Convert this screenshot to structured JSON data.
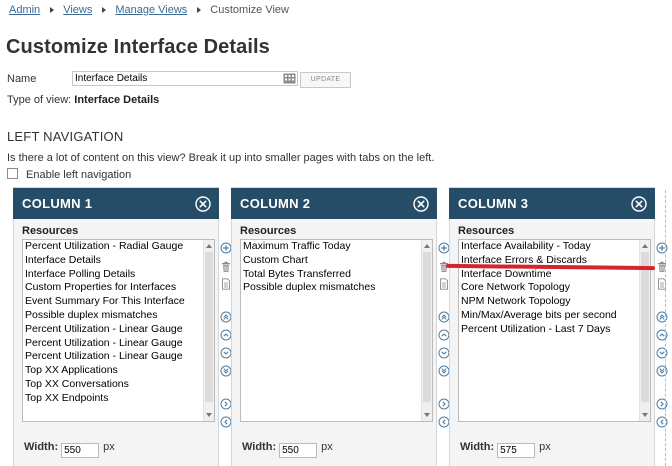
{
  "breadcrumb": {
    "items": [
      "Admin",
      "Views",
      "Manage Views"
    ],
    "current": "Customize View"
  },
  "page": {
    "title": "Customize Interface Details",
    "name_label": "Name",
    "name_value": "Interface Details",
    "update_label": "UPDATE",
    "type_prefix": "Type of view: ",
    "type_value": "Interface Details"
  },
  "left_nav": {
    "title": "LEFT NAVIGATION",
    "question": "Is there a lot of content on this view? Break it up into smaller pages with tabs on the left.",
    "enable_label": "Enable left navigation",
    "enable_checked": false
  },
  "columns": [
    {
      "title": "COLUMN 1",
      "resources_label": "Resources",
      "items": [
        "Percent Utilization - Radial Gauge",
        "Interface Details",
        "Interface Polling Details",
        "Custom Properties for Interfaces",
        "Event Summary For This Interface",
        "Possible duplex mismatches",
        "Percent Utilization - Linear Gauge",
        "Percent Utilization - Linear Gauge",
        "Percent Utilization - Linear Gauge",
        "Top XX Applications",
        "Top XX Conversations",
        "Top XX Endpoints"
      ],
      "width_label": "Width:",
      "width_value": "550",
      "width_unit": "px"
    },
    {
      "title": "COLUMN 2",
      "resources_label": "Resources",
      "items": [
        "Maximum Traffic Today",
        "Custom Chart",
        "Total Bytes Transferred",
        "Possible duplex mismatches"
      ],
      "width_label": "Width:",
      "width_value": "550",
      "width_unit": "px"
    },
    {
      "title": "COLUMN 3",
      "resources_label": "Resources",
      "items": [
        "Interface Availability - Today",
        "Interface Errors & Discards",
        "Interface Downtime",
        "Core Network Topology",
        "NPM Network Topology",
        "Min/Max/Average bits per second",
        "Percent Utilization - Last 7 Days"
      ],
      "width_label": "Width:",
      "width_value": "575",
      "width_unit": "px"
    }
  ],
  "icons": {
    "add": "plus-circle-icon",
    "delete": "trash-icon",
    "edit": "document-icon",
    "move_top": "double-chevron-up-icon",
    "move_up": "chevron-up-icon",
    "move_down": "chevron-down-icon",
    "move_bottom": "double-chevron-down-icon",
    "move_right": "chevron-right-icon",
    "move_left": "chevron-left-icon",
    "close": "close-circle-icon"
  },
  "colors": {
    "column_header": "#264d67",
    "link": "#3a6a94",
    "annotation": "#d6242b"
  }
}
